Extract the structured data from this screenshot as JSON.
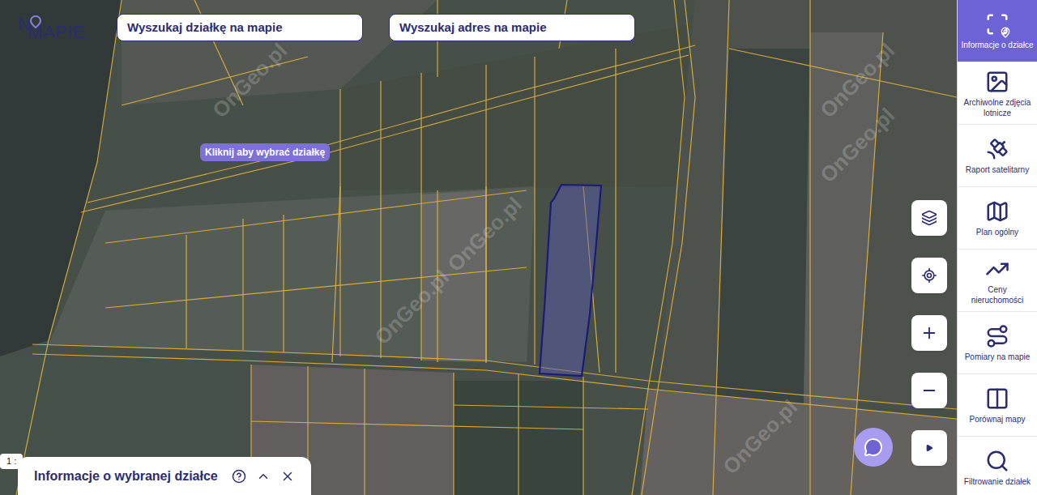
{
  "logo": {
    "first": "N",
    "rest": "MAPIE"
  },
  "search": [
    {
      "placeholder": "Wyszukaj działkę na mapie"
    },
    {
      "placeholder": "Wyszukaj adres na mapie"
    }
  ],
  "map": {
    "hint": "Kliknij aby wybrać działkę",
    "watermark": "OnGeo.pl",
    "scale": "1 :"
  },
  "sidebar": {
    "items": [
      {
        "label": "Informacje o działce",
        "selected": true
      },
      {
        "label": "Archiwolne zdjęcia lotnicze",
        "selected": false
      },
      {
        "label": "Raport satelitarny",
        "selected": false
      },
      {
        "label": "Plan ogólny",
        "selected": false
      },
      {
        "label": "Ceny nieruchomości",
        "selected": false
      },
      {
        "label": "Pomiary na mapie",
        "selected": false
      },
      {
        "label": "Porównaj mapy",
        "selected": false
      },
      {
        "label": "Filtrowanie działek",
        "selected": false
      }
    ]
  },
  "info_panel": {
    "title": "Informacje o wybranej działce",
    "help": "?"
  }
}
